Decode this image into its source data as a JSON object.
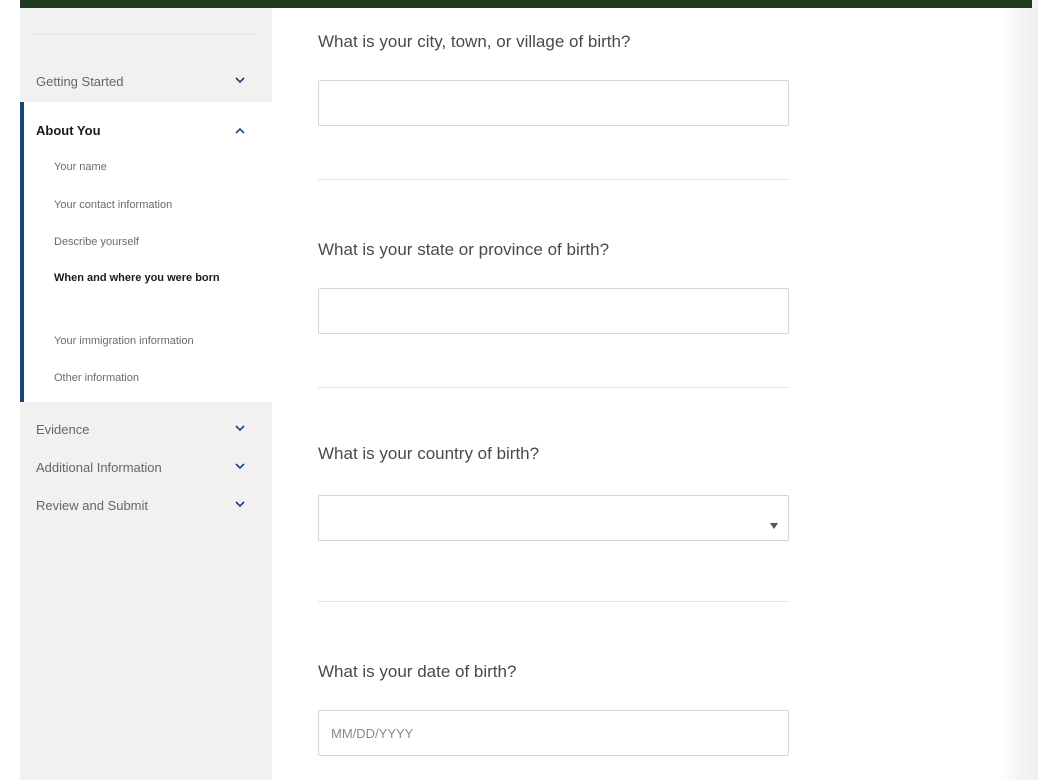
{
  "colors": {
    "top_bar": "#1f3a1f",
    "active_accent": "#1a4480",
    "sidebar_bg": "#f1f1f1"
  },
  "sidebar": {
    "sections": [
      {
        "label": "Getting Started",
        "icon": "chevron-down-icon"
      },
      {
        "label": "About You",
        "icon": "chevron-up-icon",
        "expanded": true
      },
      {
        "label": "Evidence",
        "icon": "chevron-down-icon"
      },
      {
        "label": "Additional Information",
        "icon": "chevron-down-icon"
      },
      {
        "label": "Review and Submit",
        "icon": "chevron-down-icon"
      }
    ],
    "about_items": [
      {
        "label": "Your name"
      },
      {
        "label": "Your contact information"
      },
      {
        "label": "Describe yourself"
      },
      {
        "label": "When and where you were born",
        "active": true
      },
      {
        "label": "Your immigration information"
      },
      {
        "label": "Other information"
      }
    ]
  },
  "form": {
    "city": {
      "question": "What is your city, town, or village of birth?",
      "value": ""
    },
    "state": {
      "question": "What is your state or province of birth?",
      "value": ""
    },
    "country": {
      "question": "What is your country of birth?",
      "value": ""
    },
    "dob": {
      "question": "What is your date of birth?",
      "placeholder": "MM/DD/YYYY"
    }
  }
}
